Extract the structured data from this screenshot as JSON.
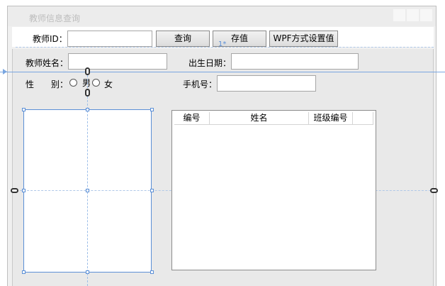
{
  "window": {
    "title": "教师信息查询"
  },
  "toolbar": {
    "teacher_id_label": "教师ID：",
    "teacher_id_value": "",
    "query_button": "查询",
    "save_button": "存值",
    "wpf_button": "WPF方式设置值"
  },
  "form": {
    "name_label": "教师姓名：",
    "name_value": "",
    "birth_label": "出生日期：",
    "birth_value": "",
    "gender_label_1": "性",
    "gender_label_2": "别：",
    "gender_male": "男",
    "gender_female": "女",
    "phone_label": "手机号：",
    "phone_value": ""
  },
  "grid": {
    "columns": [
      "编号",
      "姓名",
      "班级编号"
    ],
    "rows": []
  },
  "designer": {
    "column_marker": "1*"
  },
  "colors": {
    "selection": "#5b8fd6",
    "background": "#e9e9e9"
  }
}
